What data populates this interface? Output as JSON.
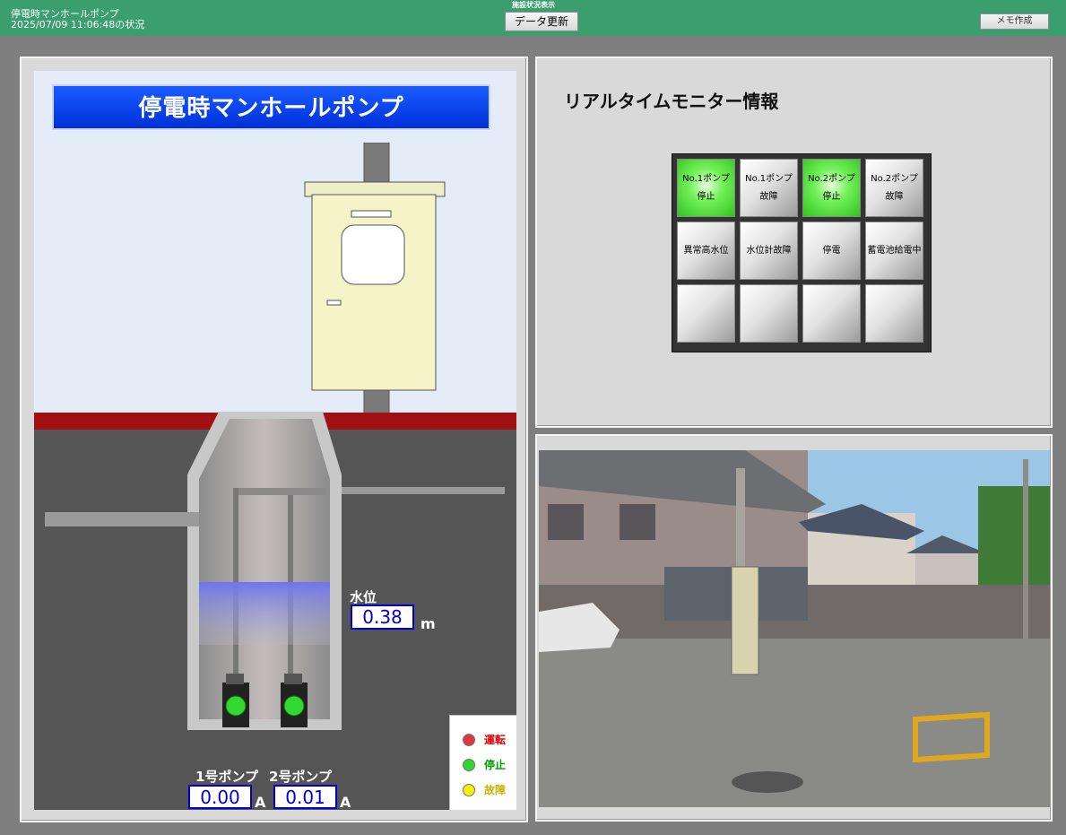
{
  "header": {
    "app_title": "停電時マンホールポンプ",
    "timestamp": "2025/07/09 11:06:48の状況",
    "center_caption": "施設状況表示",
    "refresh_label": "データ更新",
    "memo_label": "メモ作成"
  },
  "diagram": {
    "title": "停電時マンホールポンプ",
    "water_level_label": "水位",
    "water_level_value": "0.38",
    "water_level_unit": "m",
    "pump1_label": "1号ポンプ",
    "pump1_current": "0.00",
    "pump2_label": "2号ポンプ",
    "pump2_current": "0.01",
    "current_unit": "A",
    "pump1_status": "停止",
    "pump2_status": "停止"
  },
  "legend": {
    "items": [
      {
        "label": "運転",
        "color": "#e0383a",
        "text_color": "#e00000"
      },
      {
        "label": "停止",
        "color": "#2ed82e",
        "text_color": "#00a000"
      },
      {
        "label": "故障",
        "color": "#f2f200",
        "text_color": "#c8b400"
      }
    ]
  },
  "monitor": {
    "title": "リアルタイムモニター情報",
    "cells": [
      {
        "line1": "No.1ポンプ",
        "line2": "停止",
        "active": true
      },
      {
        "line1": "No.1ポンプ",
        "line2": "故障",
        "active": false
      },
      {
        "line1": "No.2ポンプ",
        "line2": "停止",
        "active": true
      },
      {
        "line1": "No.2ポンプ",
        "line2": "故障",
        "active": false
      },
      {
        "line1": "異常高水位",
        "line2": "",
        "active": false
      },
      {
        "line1": "水位計故障",
        "line2": "",
        "active": false
      },
      {
        "line1": "停電",
        "line2": "",
        "active": false
      },
      {
        "line1": "蓄電池給電中",
        "line2": "",
        "active": false
      },
      {
        "line1": "",
        "line2": "",
        "active": false
      },
      {
        "line1": "",
        "line2": "",
        "active": false
      },
      {
        "line1": "",
        "line2": "",
        "active": false
      },
      {
        "line1": "",
        "line2": "",
        "active": false
      }
    ]
  }
}
